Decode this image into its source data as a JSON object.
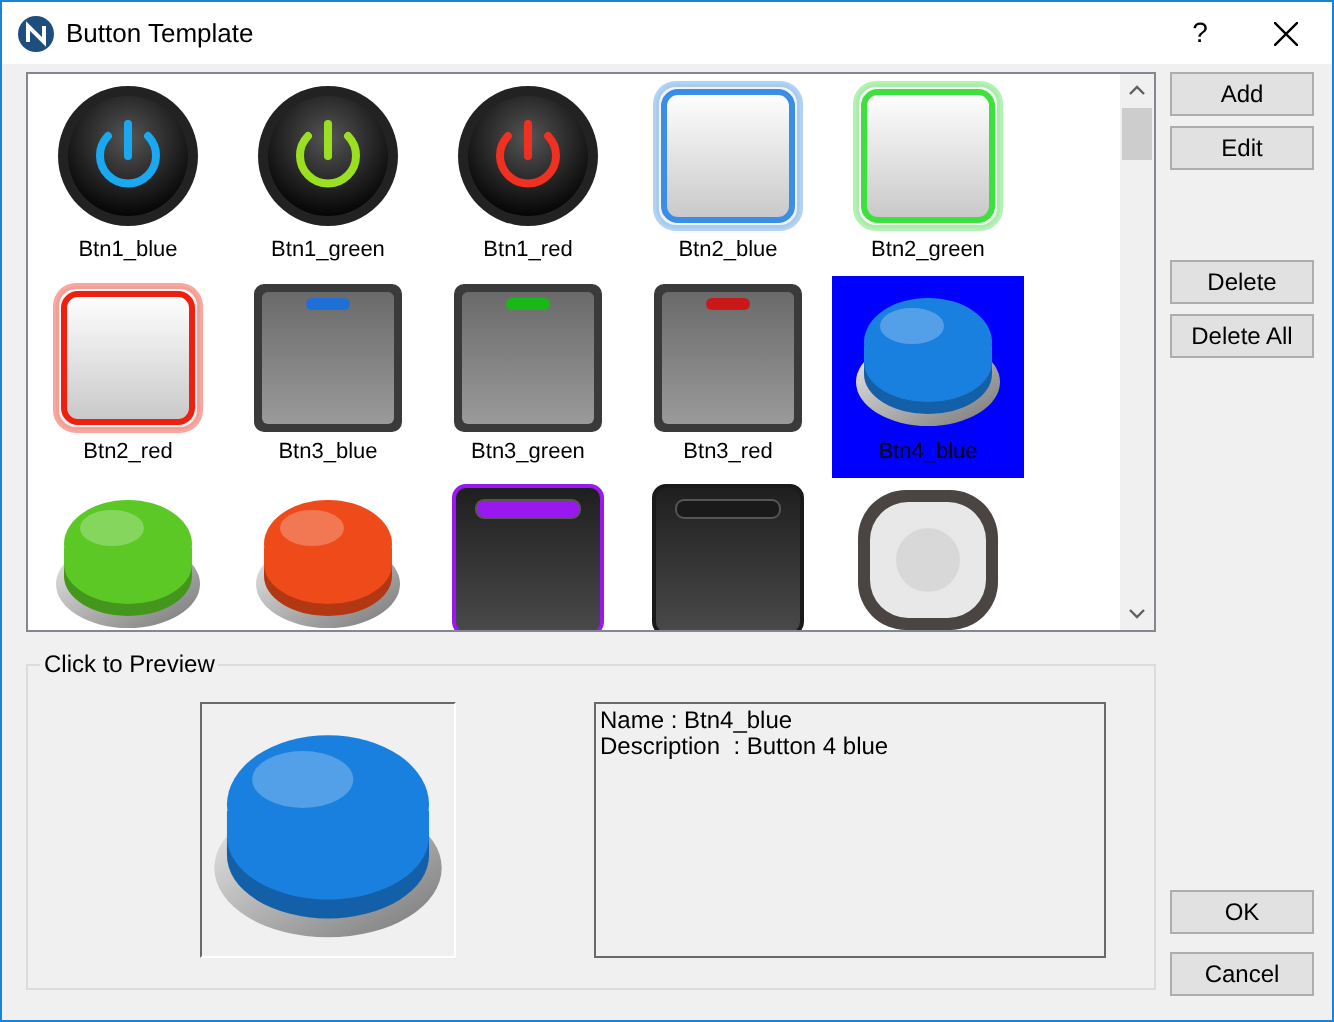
{
  "window": {
    "title": "Button Template",
    "help": "?"
  },
  "gallery": {
    "items": [
      {
        "kind": "power",
        "color": "#1aa8f0",
        "label": "Btn1_blue",
        "selected": false
      },
      {
        "kind": "power",
        "color": "#9be020",
        "label": "Btn1_green",
        "selected": false
      },
      {
        "kind": "power",
        "color": "#f03020",
        "label": "Btn1_red",
        "selected": false
      },
      {
        "kind": "frame",
        "color": "#3a8ee8",
        "label": "Btn2_blue",
        "selected": false
      },
      {
        "kind": "frame",
        "color": "#3ee040",
        "label": "Btn2_green",
        "selected": false
      },
      {
        "kind": "frame",
        "color": "#f02010",
        "label": "Btn2_red",
        "selected": false
      },
      {
        "kind": "switch",
        "color": "#1f6fd8",
        "label": "Btn3_blue",
        "selected": false
      },
      {
        "kind": "switch",
        "color": "#18b818",
        "label": "Btn3_green",
        "selected": false
      },
      {
        "kind": "switch",
        "color": "#c81818",
        "label": "Btn3_red",
        "selected": false
      },
      {
        "kind": "dome",
        "color": "#1a80e0",
        "label": "Btn4_blue",
        "selected": true
      },
      {
        "kind": "dome",
        "color": "#5cc826",
        "selected": false
      },
      {
        "kind": "dome",
        "color": "#ee4a1a",
        "selected": false
      },
      {
        "kind": "glow",
        "color": "#9a18f0",
        "selected": false
      },
      {
        "kind": "glow",
        "color": "#1a1a1a",
        "selected": false
      },
      {
        "kind": "ring",
        "color": "#e8e8e8",
        "selected": false
      }
    ]
  },
  "side_buttons": [
    "Add",
    "Edit",
    "Delete",
    "Delete All"
  ],
  "preview": {
    "legend": "Click to Preview",
    "kind": "dome",
    "color": "#1a80e0",
    "lines": [
      "Name : Btn4_blue",
      "Description  : Button 4 blue"
    ]
  },
  "footer_buttons": [
    "OK",
    "Cancel"
  ]
}
